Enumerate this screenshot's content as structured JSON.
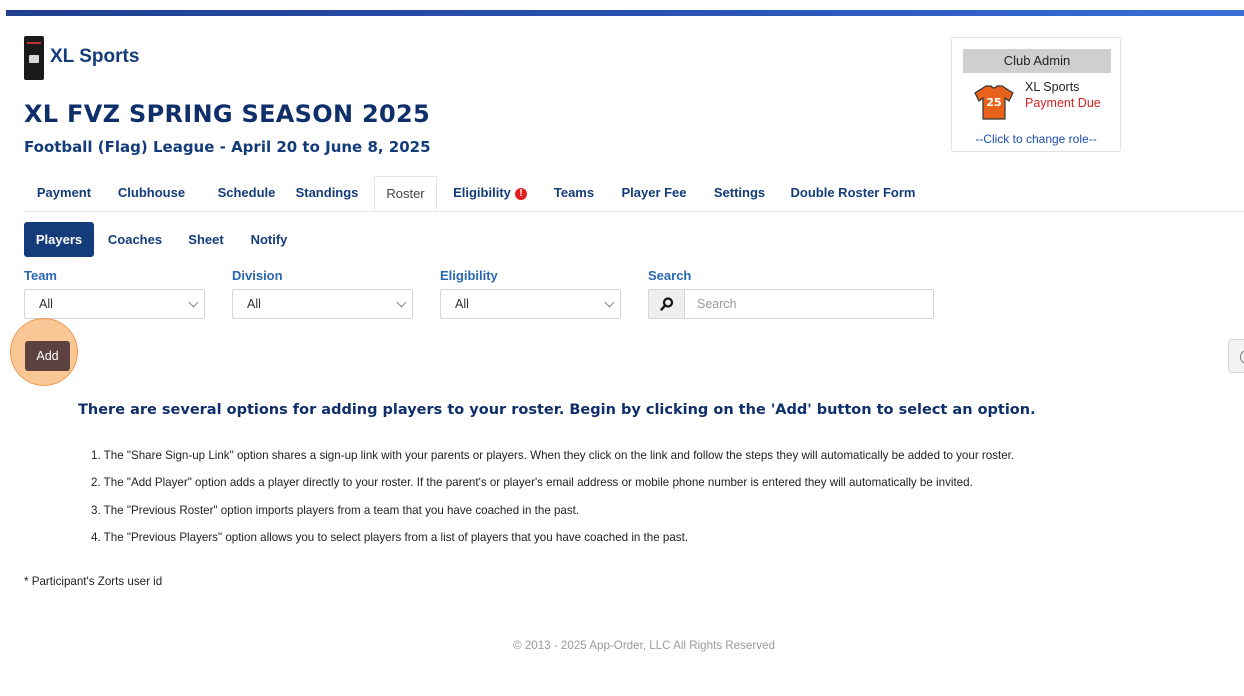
{
  "header": {
    "club_name": "XL Sports",
    "season_title": "XL FVZ SPRING SEASON 2025",
    "season_subtitle": "Football (Flag) League  -  April 20 to June 8, 2025"
  },
  "role_card": {
    "title": "Club Admin",
    "club": "XL Sports",
    "status": "Payment Due",
    "jersey_number": "25",
    "change_link": "--Click to change role--"
  },
  "main_tabs": [
    {
      "label": "Payment"
    },
    {
      "label": "Clubhouse"
    },
    {
      "label": "Schedule"
    },
    {
      "label": "Standings"
    },
    {
      "label": "Roster",
      "active": true
    },
    {
      "label": "Eligibility",
      "alert": "!"
    },
    {
      "label": "Teams"
    },
    {
      "label": "Player Fee"
    },
    {
      "label": "Settings"
    },
    {
      "label": "Double Roster Form"
    }
  ],
  "sub_tabs": [
    {
      "label": "Players",
      "active": true
    },
    {
      "label": "Coaches"
    },
    {
      "label": "Sheet"
    },
    {
      "label": "Notify"
    }
  ],
  "filters": {
    "team": {
      "label": "Team",
      "value": "All"
    },
    "division": {
      "label": "Division",
      "value": "All"
    },
    "eligibility": {
      "label": "Eligibility",
      "value": "All"
    },
    "search": {
      "label": "Search",
      "placeholder": "Search",
      "icon": "search-icon"
    }
  },
  "add_button": "Add",
  "instructions": {
    "heading": "There are several options for adding players to your roster. Begin by clicking on the 'Add' button to select an option.",
    "items": [
      "1. The \"Share Sign-up Link\" option shares a sign-up link with your parents or players. When they click on the link and follow the steps they will automatically be added to your roster.",
      "2. The \"Add Player\" option adds a player directly to your roster. If the parent's or player's email address or mobile phone number is entered they will automatically be invited.",
      "3. The \"Previous Roster\" option imports players from a team that you have coached in the past.",
      "4. The \"Previous Players\" option allows you to select players from a list of players that you have coached in the past."
    ]
  },
  "footnote": "* Participant's Zorts user id",
  "copyright": "© 2013 - 2025 App-Order, LLC All Rights Reserved",
  "colors": {
    "brand_navy": "#143c7a",
    "link_blue": "#2a67b3",
    "alert_red": "#d42020",
    "add_button": "#5b4240",
    "highlight": "#f6b06e"
  }
}
